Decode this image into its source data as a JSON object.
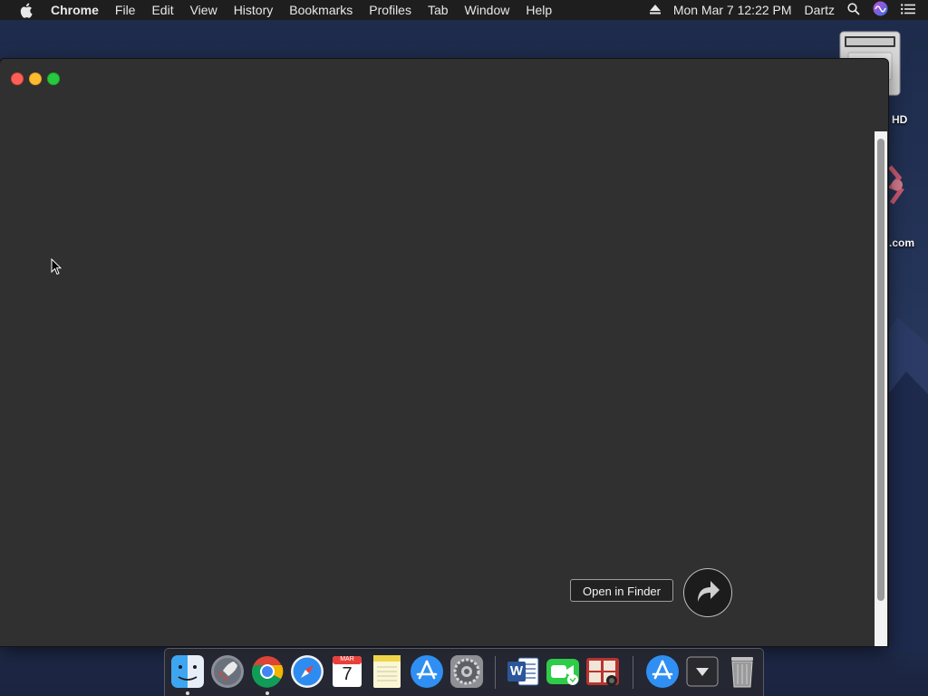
{
  "menubar": {
    "app_name": "Chrome",
    "items": [
      "File",
      "Edit",
      "View",
      "History",
      "Bookmarks",
      "Profiles",
      "Tab",
      "Window",
      "Help"
    ],
    "clock": "Mon Mar 7  12:22 PM",
    "user": "Dartz",
    "icons": [
      "apple-icon",
      "eject-icon",
      "spotlight-search-icon",
      "siri-icon",
      "notification-center-icon"
    ]
  },
  "desktop": {
    "hd_label": "HD",
    "com_label": ".com"
  },
  "window": {
    "open_in_finder_label": "Open in Finder",
    "share_icon": "share-arrow-icon"
  },
  "dock": {
    "items": [
      {
        "name": "finder",
        "running": true
      },
      {
        "name": "launchpad",
        "running": false
      },
      {
        "name": "chrome",
        "running": true
      },
      {
        "name": "safari",
        "running": false
      },
      {
        "name": "calendar",
        "running": false,
        "month": "MAR",
        "day": "7"
      },
      {
        "name": "notes",
        "running": false
      },
      {
        "name": "app-store",
        "running": false
      },
      {
        "name": "system-preferences",
        "running": false
      },
      {
        "name": "word",
        "running": false,
        "letter": "W"
      },
      {
        "name": "facetime",
        "running": false
      },
      {
        "name": "photo-booth",
        "running": false
      },
      {
        "name": "app-store-downloads",
        "running": false
      },
      {
        "name": "downloads-stack",
        "running": false
      },
      {
        "name": "trash",
        "running": false
      }
    ]
  },
  "colors": {
    "window_bg": "#303030",
    "menubar_bg": "#1e1e1e",
    "close": "#fe5f57",
    "minimize": "#febc2e",
    "zoom": "#28c840"
  }
}
